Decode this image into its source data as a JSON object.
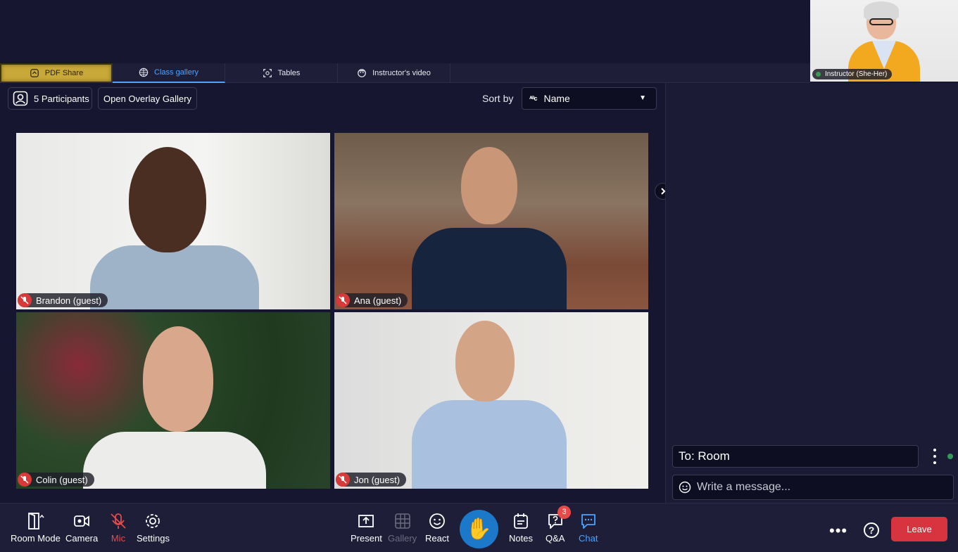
{
  "instructor": {
    "label": "Instructor (She-Her)"
  },
  "tabs": [
    {
      "label": "PDF Share",
      "icon": "pdf-share-icon"
    },
    {
      "label": "Class gallery",
      "icon": "grid-icon"
    },
    {
      "label": "Tables",
      "icon": "tables-icon"
    },
    {
      "label": "Instructor's video",
      "icon": "instructor-video-icon"
    }
  ],
  "toolbar_top": {
    "participants_label": "5 Participants",
    "overlay_label": "Open Overlay Gallery",
    "sort_label": "Sort by",
    "sort_value": "Name",
    "sort_icon_text": "ᴬᴮc"
  },
  "participants": [
    {
      "name": "Brandon (guest)",
      "muted": true
    },
    {
      "name": "Ana (guest)",
      "muted": true
    },
    {
      "name": "Colin (guest)",
      "muted": true
    },
    {
      "name": "Jon (guest)",
      "muted": true
    }
  ],
  "chat": {
    "recipient": "To: Room",
    "placeholder": "Write a message..."
  },
  "bottom_bar": {
    "room_mode": "Room Mode",
    "camera": "Camera",
    "mic": "Mic",
    "settings": "Settings",
    "present": "Present",
    "gallery": "Gallery",
    "react": "React",
    "raise_hand": "✋",
    "notes": "Notes",
    "qa": "Q&A",
    "qa_badge": "3",
    "chat": "Chat",
    "more": "•••",
    "help": "?",
    "leave": "Leave"
  },
  "colors": {
    "background": "#161630",
    "accent_blue": "#4da3ff",
    "leave_red": "#d8343f",
    "muted_red": "#d83a3a",
    "pdf_tab": "#c8a838"
  }
}
